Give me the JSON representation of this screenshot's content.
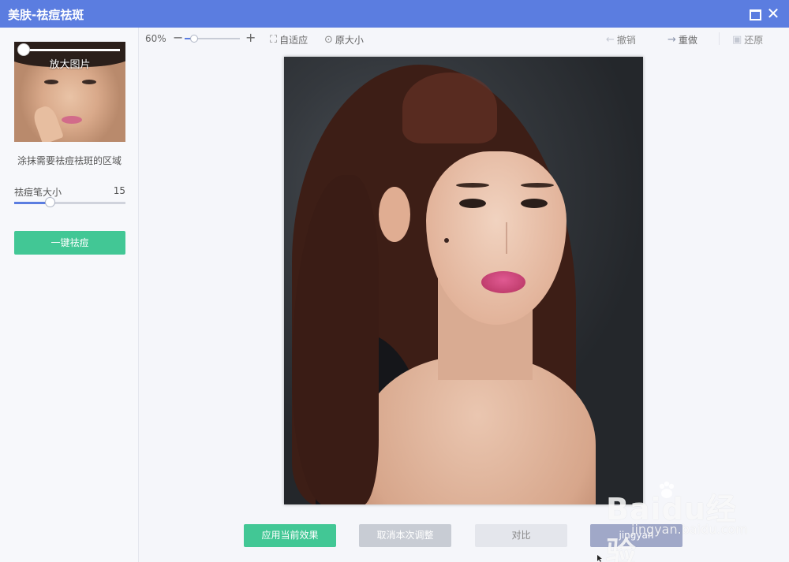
{
  "window": {
    "title": "美肤-祛痘祛斑"
  },
  "sidebar": {
    "thumbnail_label": "放大图片",
    "hint": "涂抹需要祛痘祛斑的区域",
    "brush_size_label": "祛痘笔大小",
    "brush_size_value": "15",
    "brush_size_fraction": 0.32,
    "one_click_button": "一键祛痘"
  },
  "toolbar": {
    "zoom_percent": "60%",
    "zoom_fraction": 0.17,
    "fit_label": "自适应",
    "original_size_label": "原大小",
    "undo_label": "撤销",
    "redo_label": "重做",
    "restore_label": "还原"
  },
  "actions": {
    "apply_label": "应用当前效果",
    "cancel_label": "取消本次调整",
    "compare_label": "对比",
    "save_label": "jingyan"
  },
  "watermark": {
    "brand": "Baidu经验",
    "url": "jingyan.baidu.com"
  },
  "colors": {
    "title_bar": "#5b7de0",
    "primary_green": "#42c795",
    "accent_blue": "#5b7de0"
  },
  "icons": [
    "maximize-icon",
    "close-icon",
    "zoom-out-icon",
    "zoom-in-icon",
    "fit-icon",
    "original-size-icon",
    "undo-icon",
    "redo-icon",
    "restore-icon",
    "cursor-icon"
  ]
}
